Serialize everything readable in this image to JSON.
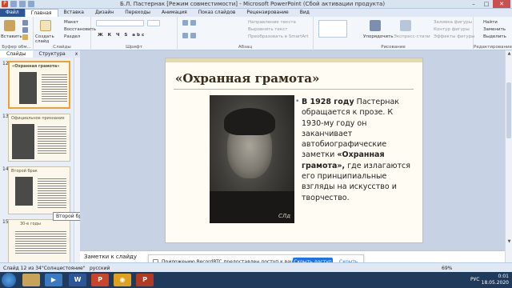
{
  "window": {
    "title": "Б.Л. Пастернак [Режим совместимости] - Microsoft PowerPoint (Сбой активации продукта)",
    "controls": [
      "–",
      "□",
      "✕"
    ]
  },
  "ribbon_tabs": [
    {
      "label": "Файл"
    },
    {
      "label": "Главная"
    },
    {
      "label": "Вставка"
    },
    {
      "label": "Дизайн"
    },
    {
      "label": "Переходы"
    },
    {
      "label": "Анимация"
    },
    {
      "label": "Показ слайдов"
    },
    {
      "label": "Рецензирование"
    },
    {
      "label": "Вид"
    }
  ],
  "ribbon": {
    "clipboard": {
      "group": "Буфер обм...",
      "paste": "Вставить"
    },
    "slides": {
      "group": "Слайды",
      "new_slide": "Создать слайд",
      "layout": "Макет",
      "reset": "Восстановить",
      "section": "Раздел"
    },
    "font": {
      "group": "Шрифт",
      "font_name": "",
      "font_size": "",
      "buttons": "Ж К Ч S abc"
    },
    "paragraph": {
      "group": "Абзац",
      "direction": "Направление текста",
      "align": "Выровнять текст",
      "smartart": "Преобразовать в SmartArt"
    },
    "drawing": {
      "group": "Рисование",
      "arrange": "Упорядочить",
      "quick_styles": "Экспресс-стили",
      "fill": "Заливка фигуры",
      "outline": "Контур фигуры",
      "effects": "Эффекты фигуры"
    },
    "editing": {
      "group": "Редактирование",
      "find": "Найти",
      "replace": "Заменить",
      "select": "Выделить"
    }
  },
  "pane": {
    "tabs": [
      "Слайды",
      "Структура"
    ],
    "close": "x",
    "thumbnails": [
      {
        "num": "12",
        "title": "«Охранная грамота»"
      },
      {
        "num": "13",
        "title": "Официальное признание"
      },
      {
        "num": "14",
        "title": "Второй брак"
      },
      {
        "num": "15",
        "title": "30-е годы"
      }
    ],
    "tooltip": "Второй брак"
  },
  "slide": {
    "title": "«Охранная грамота»",
    "photo_signature": "СЛд",
    "body_lead": "В 1928 году",
    "body_part1": " Пастернак обращается к прозе. К 1930-му году он заканчивает автобиографические заметки ",
    "body_bold": "«Охранная грамота»,",
    "body_part2": " где излагаются его принципиальные взгляды на искусство и творчество."
  },
  "notes": {
    "placeholder": "Заметки к слайду"
  },
  "notification": {
    "text": "Приложению RecordRTC предоставлен доступ к вашему экрану.",
    "share_button": "Скрыть доступ",
    "hide_link": "Скрыть"
  },
  "status": {
    "slide_counter": "Слайд 12 из 34",
    "theme": "\"Солнцестояние\"",
    "language": "русский",
    "zoom": "69%"
  },
  "taskbar": {
    "apps": [
      "W",
      "P",
      "◉",
      "P"
    ],
    "lang": "РУС",
    "time": "0:01",
    "date": "18.05.2020"
  },
  "colors": {
    "accent": "#2a5699",
    "slide_bg": "#fffdf3",
    "title": "#3a2a1a",
    "bullet": "#5b7fb5"
  }
}
